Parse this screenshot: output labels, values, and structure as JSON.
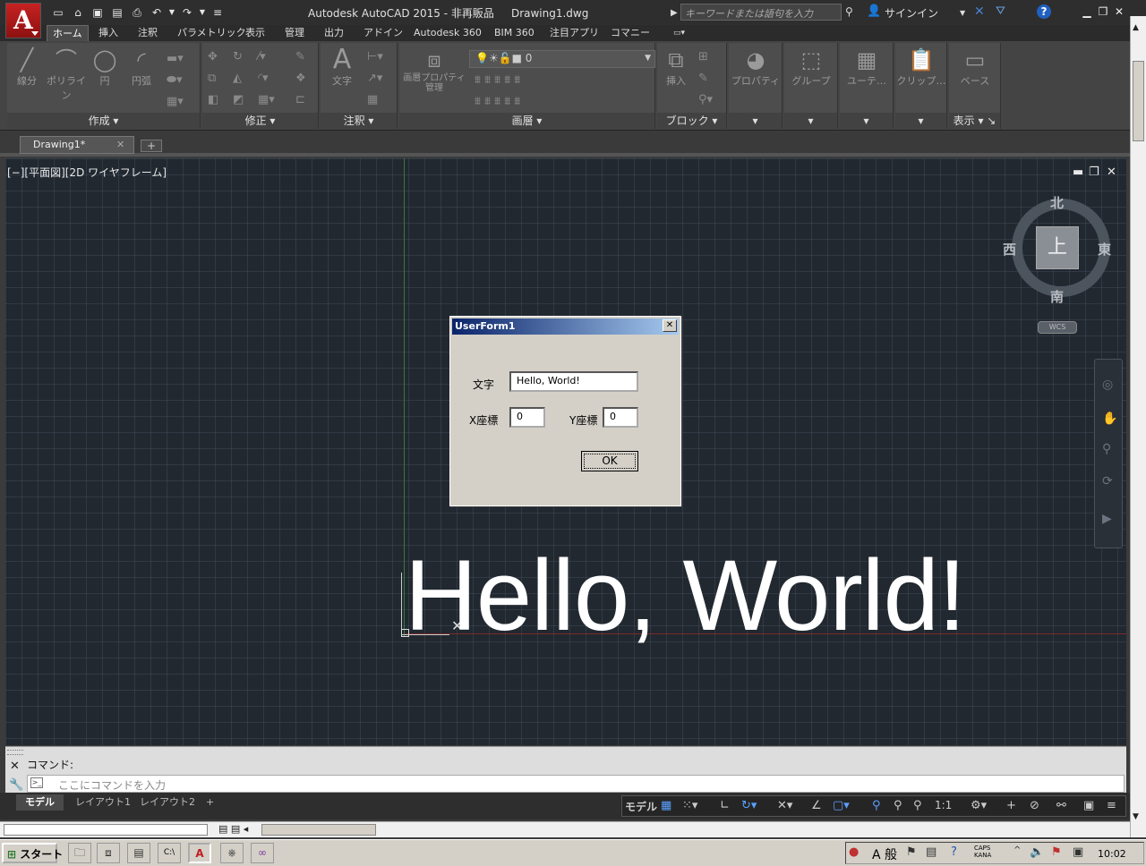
{
  "titlebar": {
    "title": "Autodesk AutoCAD 2015 - 非再販品     Drawing1.dwg",
    "search_placeholder": "キーワードまたは語句を入力",
    "signin": "サインイン",
    "help": "?"
  },
  "ribbon_tabs": [
    "ホーム",
    "挿入",
    "注釈",
    "パラメトリック",
    "表示",
    "管理",
    "出力",
    "アドイン",
    "Autodesk 360",
    "BIM 360",
    "注目アプリ",
    "コマニー"
  ],
  "panels": {
    "draw": {
      "title": "作成",
      "tools": [
        "線分",
        "ポリライン",
        "円",
        "円弧"
      ]
    },
    "modify": {
      "title": "修正"
    },
    "annotation": {
      "title": "注釈",
      "tools": [
        "文字"
      ]
    },
    "layers": {
      "title": "画層",
      "tools": [
        "画層プロパティ管理"
      ]
    },
    "block": {
      "title": "ブロック",
      "tools": [
        "挿入"
      ]
    },
    "properties": {
      "tools": [
        "プロパティ"
      ]
    },
    "groups": {
      "tools": [
        "グループ"
      ]
    },
    "utilities": {
      "tools": [
        "ユーテ…"
      ]
    },
    "clipboard": {
      "tools": [
        "クリップ…"
      ]
    },
    "view": {
      "title": "表示",
      "tools": [
        "ベース"
      ]
    }
  },
  "doc_tab": {
    "label": "Drawing1*"
  },
  "viewport": {
    "label": "[−][平面図][2D ワイヤフレーム]",
    "drawing_text": "Hello, World!"
  },
  "viewcube": {
    "north": "北",
    "south": "南",
    "east": "東",
    "west": "西",
    "top": "上",
    "wcs": "WCS"
  },
  "dialog": {
    "title": "UserForm1",
    "text_label": "文字",
    "text_value": "Hello, World!",
    "x_label": "X座標",
    "x_value": "0",
    "y_label": "Y座標",
    "y_value": "0",
    "ok_label": "OK"
  },
  "command": {
    "history": "コマンド:",
    "placeholder": "ここにコマンドを入力"
  },
  "layout_tabs": [
    "モデル",
    "レイアウト1",
    "レイアウト2"
  ],
  "status": {
    "model": "モデル",
    "scale": "1:1"
  },
  "taskbar": {
    "start": "スタート",
    "ime": "A 般",
    "caps": "CAPS",
    "kana": "KANA",
    "clock": "10:02"
  }
}
